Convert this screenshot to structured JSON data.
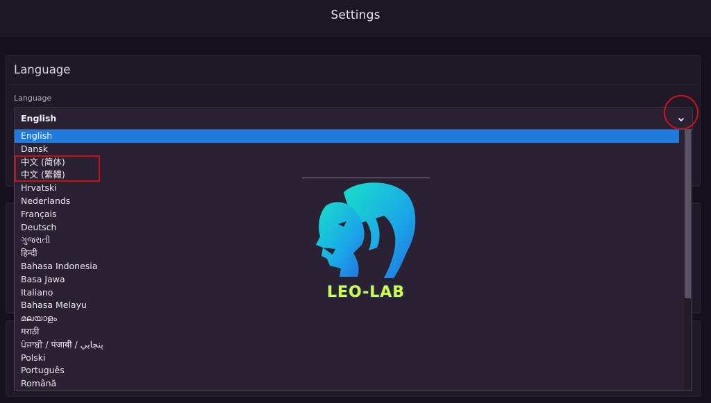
{
  "header": {
    "title": "Settings"
  },
  "language_section": {
    "heading": "Language",
    "field_label": "Language",
    "selected_value": "English"
  },
  "dropdown": {
    "options": [
      "English",
      "Dansk",
      "中文 (简体)",
      "中文 (繁體)",
      "Hrvatski",
      "Nederlands",
      "Français",
      "Deutsch",
      "ગુજરાતી",
      "हिन्दी",
      "Bahasa Indonesia",
      "Basa Jawa",
      "Italiano",
      "Bahasa Melayu",
      "മലയാളം",
      "मराठी",
      "ਪੰਜਾਬੀ / पंजाबी / پنجابي",
      "Polski",
      "Português",
      "Română"
    ],
    "selected_index": 0
  },
  "logo": {
    "text": "LEO-LAB"
  },
  "colors": {
    "background": "#15101b",
    "panel": "#1f1826",
    "selected_option": "#1f7ae0",
    "annotation_red": "#d4101a",
    "logo_teal": "#1ec8d8",
    "logo_text": "#d8ff3a"
  }
}
